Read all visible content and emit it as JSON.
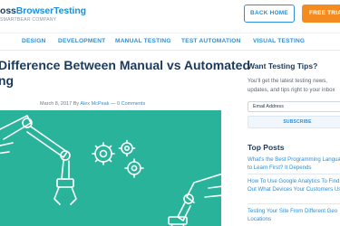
{
  "header": {
    "logo_prefix": "oss",
    "logo_brand": "BrowserTesting",
    "logo_sub": "SMARTBEAR COMPANY",
    "back_home": "BACK HOME",
    "free_trial": "FREE TRIAL"
  },
  "nav": {
    "items": [
      "DESIGN",
      "DEVELOPMENT",
      "MANUAL TESTING",
      "TEST AUTOMATION",
      "VISUAL TESTING"
    ]
  },
  "article": {
    "title_line1": "Difference Between Manual vs Automated",
    "title_line2": "ng",
    "date": "March 8, 2017",
    "by": "By",
    "author": "Alex McPeak",
    "separator": "—",
    "comments": "0 Comments"
  },
  "sidebar": {
    "tips_heading": "Want Testing Tips?",
    "tips_text": "You'll get the latest testing news, updates, and tips right to your inbox",
    "email_placeholder": "Email Address",
    "subscribe_label": "SUBSCRIBE",
    "top_posts_heading": "Top Posts",
    "posts": [
      "What's the Best Programming Language to Learn First? It Depends",
      "How To Use Google Analytics To Find Out What Devices Your Customers Use",
      "Testing Your Site From Different Geo Locations"
    ]
  },
  "colors": {
    "brand_blue": "#2d8fd5",
    "navy": "#1b3a5c",
    "trial_orange": "#f38b1f",
    "hero_green": "#2ab39b"
  }
}
